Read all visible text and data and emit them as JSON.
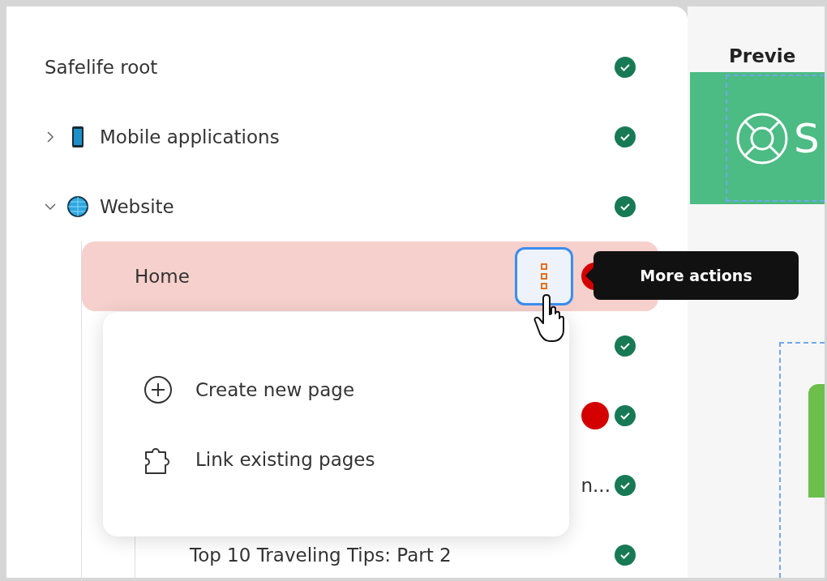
{
  "tree": {
    "label": "Safelife root",
    "done": true,
    "selected": false,
    "children": [
      {
        "label": "Mobile applications",
        "kind": "app",
        "expanded": false,
        "done": true,
        "selected": false
      },
      {
        "label": "Website",
        "kind": "site",
        "expanded": true,
        "done": true,
        "selected": false,
        "children": [
          {
            "label": "Home",
            "selected": true,
            "alert": true
          },
          {
            "done": true,
            "selected": false,
            "children": [
              {
                "alert": true,
                "done": true,
                "selected": false
              },
              {
                "label": "n...",
                "done": true,
                "selected": false
              },
              {
                "label": "Top 10 Traveling Tips: Part 2",
                "done": true,
                "selected": false
              }
            ]
          }
        ]
      }
    ]
  },
  "tooltip": "More actions",
  "menu": [
    {
      "kind": "create",
      "label": "Create new page"
    },
    {
      "kind": "link",
      "label": "Link existing pages"
    }
  ],
  "preview": {
    "title": "Previe",
    "banner_text": "S"
  }
}
